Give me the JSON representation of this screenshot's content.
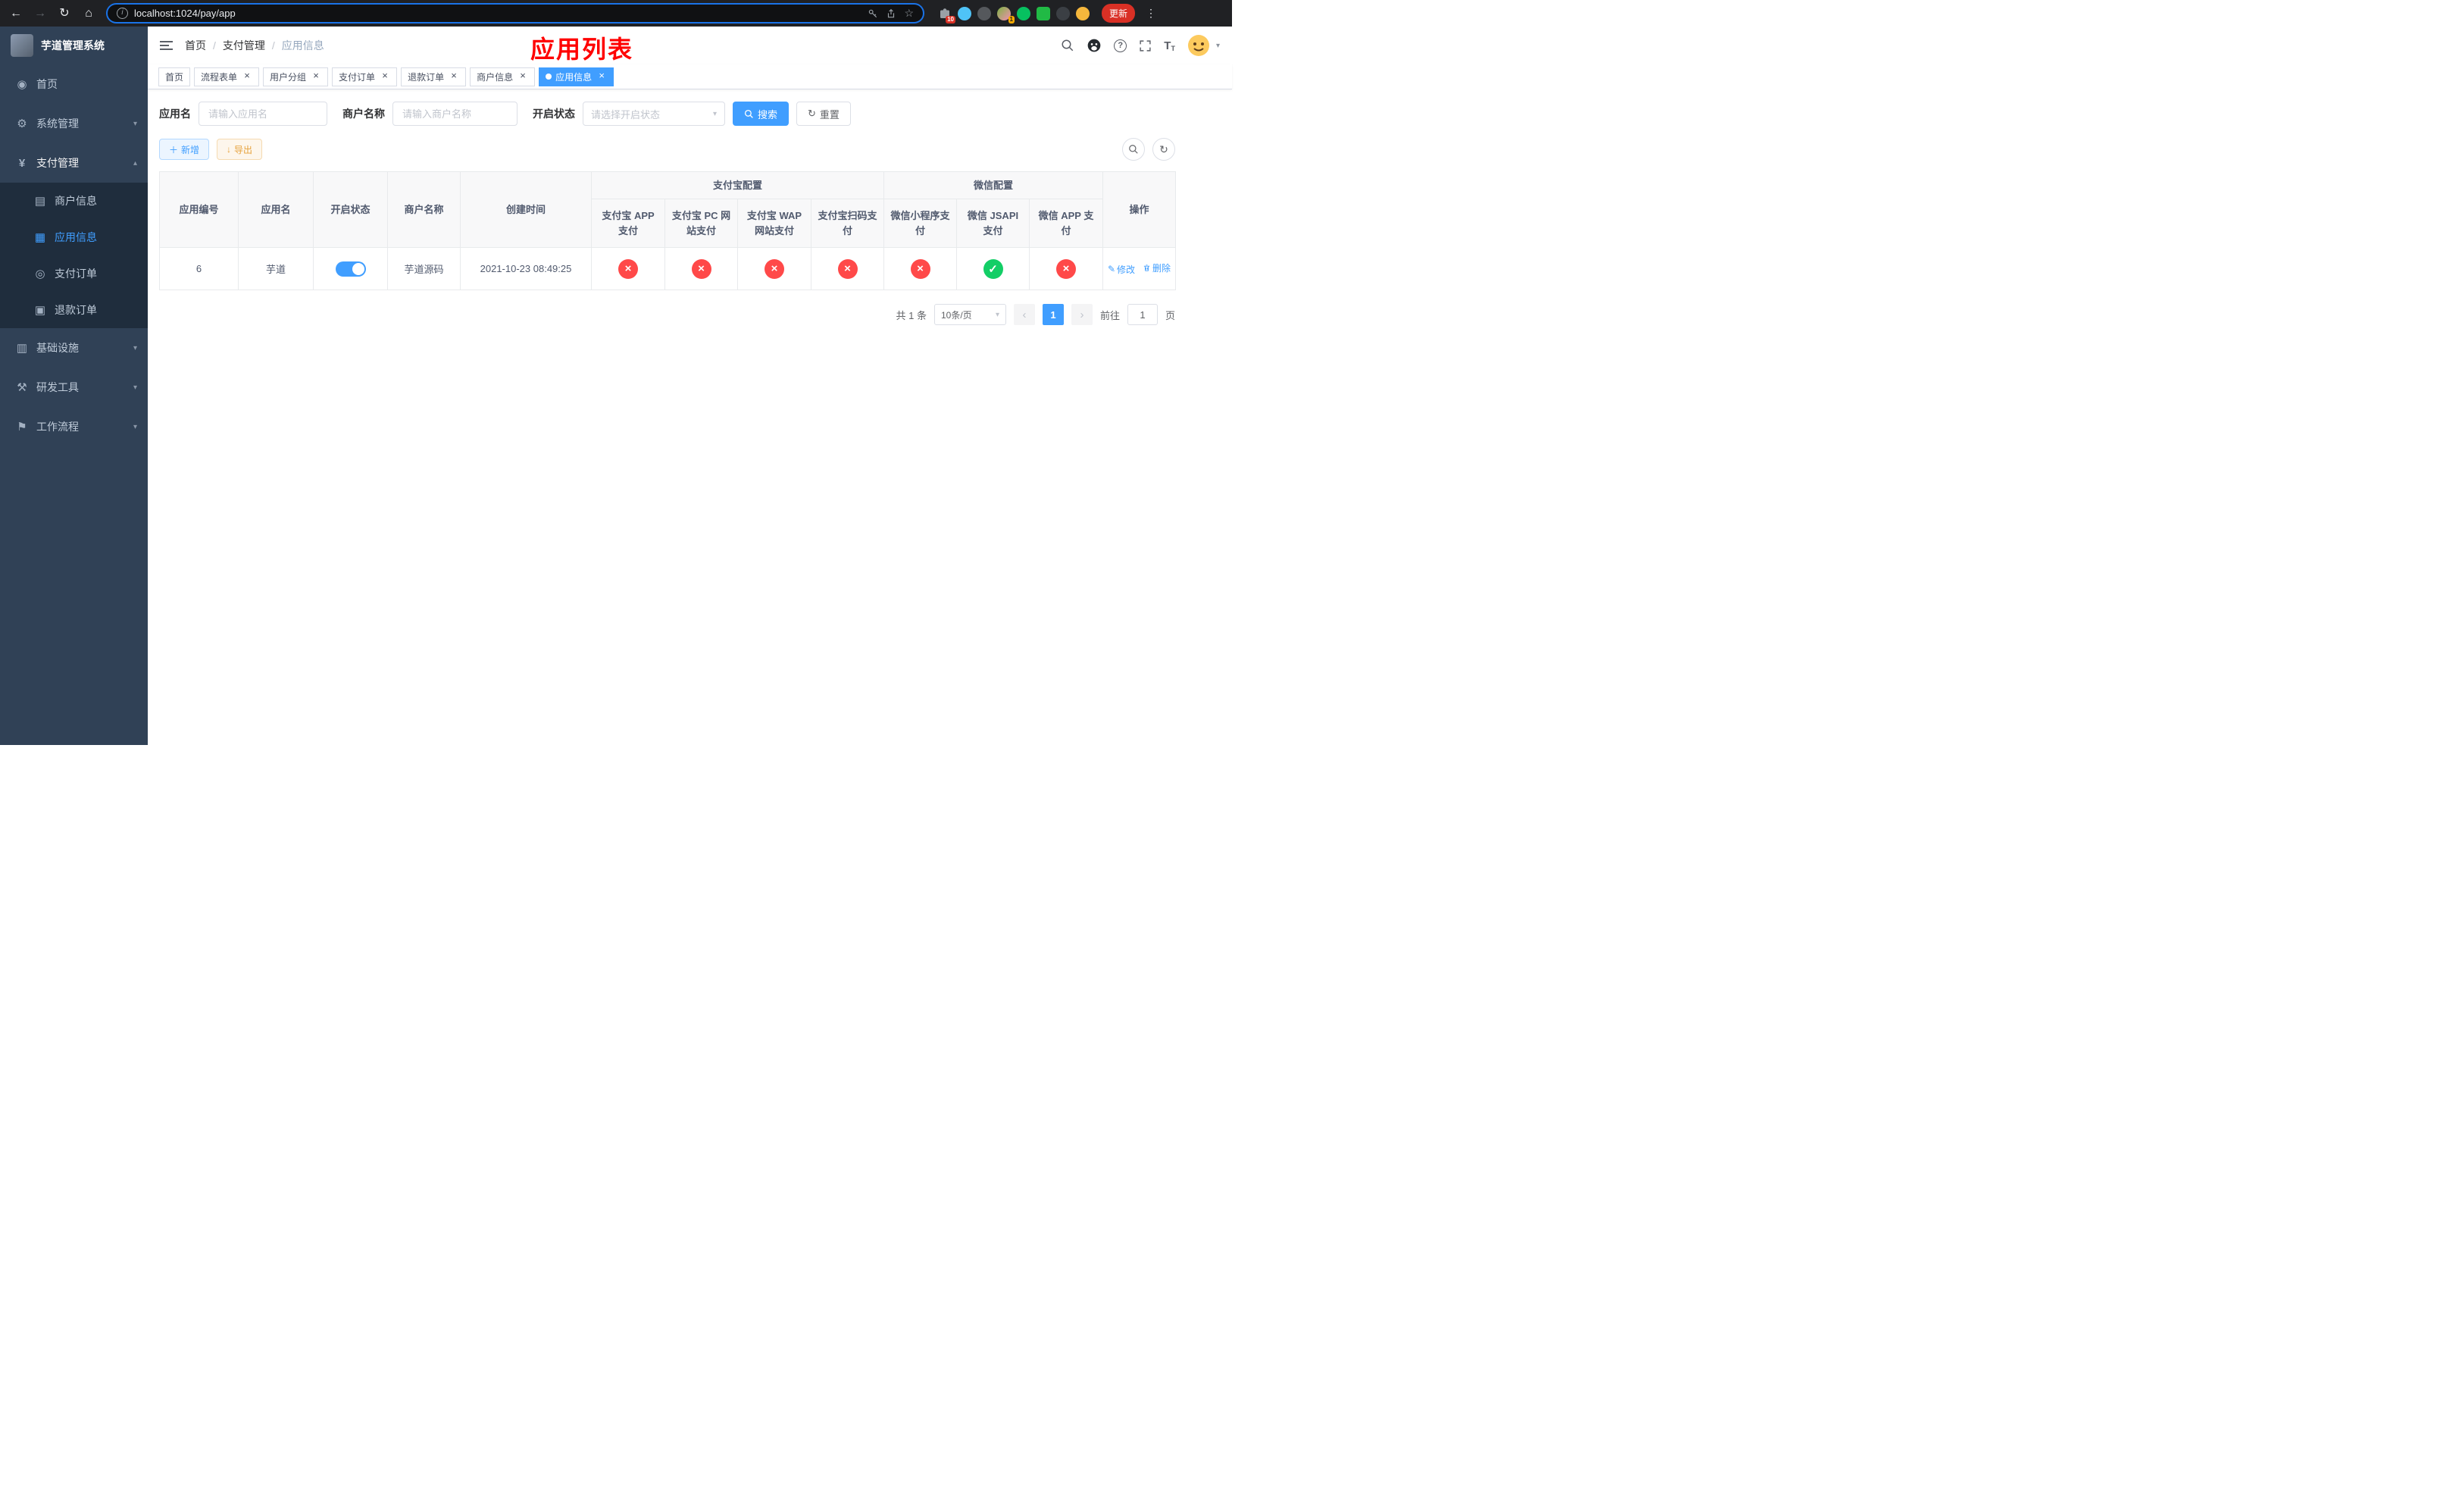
{
  "colors": {
    "primary": "#409EFF",
    "success": "#13ce66",
    "danger": "#ff4949",
    "warning": "#e6a23c",
    "annotation_red": "#ff0000",
    "sidebar_bg": "#304156",
    "sidebar_sub_bg": "#1f2d3d"
  },
  "browser": {
    "url": "localhost:1024/pay/app",
    "update_button": "更新",
    "extension_badge_red": "10",
    "extension_badge_green": "1"
  },
  "annotation": {
    "title": "应用列表"
  },
  "sidebar": {
    "app_title": "芋道管理系统",
    "items": {
      "home": "首页",
      "system": "系统管理",
      "payment": "支付管理",
      "infra": "基础设施",
      "devtools": "研发工具",
      "workflow": "工作流程"
    },
    "payment_children": {
      "merchant": "商户信息",
      "app": "应用信息",
      "order": "支付订单",
      "refund": "退款订单"
    }
  },
  "breadcrumb": {
    "items": [
      "首页",
      "支付管理",
      "应用信息"
    ]
  },
  "tabs": [
    {
      "label": "首页",
      "closable": false,
      "active": false
    },
    {
      "label": "流程表单",
      "closable": true,
      "active": false
    },
    {
      "label": "用户分组",
      "closable": true,
      "active": false
    },
    {
      "label": "支付订单",
      "closable": true,
      "active": false
    },
    {
      "label": "退款订单",
      "closable": true,
      "active": false
    },
    {
      "label": "商户信息",
      "closable": true,
      "active": false
    },
    {
      "label": "应用信息",
      "closable": true,
      "active": true
    }
  ],
  "filters": {
    "app_name_label": "应用名",
    "app_name_placeholder": "请输入应用名",
    "merchant_label": "商户名称",
    "merchant_placeholder": "请输入商户名称",
    "status_label": "开启状态",
    "status_placeholder": "请选择开启状态",
    "search_button": "搜索",
    "reset_button": "重置"
  },
  "toolbar": {
    "add_button": "新增",
    "export_button": "导出"
  },
  "table": {
    "group_headers": {
      "alipay": "支付宝配置",
      "wechat": "微信配置"
    },
    "columns": [
      "应用编号",
      "应用名",
      "开启状态",
      "商户名称",
      "创建时间",
      "支付宝 APP 支付",
      "支付宝 PC 网站支付",
      "支付宝 WAP 网站支付",
      "支付宝扫码支付",
      "微信小程序支付",
      "微信 JSAPI 支付",
      "微信 APP 支付",
      "操作"
    ],
    "row": {
      "id": "6",
      "name": "芋道",
      "status_on": true,
      "merchant": "芋道源码",
      "created": "2021-10-23 08:49:25",
      "channels": [
        "fail",
        "fail",
        "fail",
        "fail",
        "fail",
        "success",
        "fail"
      ],
      "edit_label": "修改",
      "delete_label": "删除"
    }
  },
  "pagination": {
    "total": "共 1 条",
    "page_size": "10条/页",
    "page": "1",
    "goto_prefix": "前往",
    "goto_value": "1",
    "goto_suffix": "页"
  }
}
